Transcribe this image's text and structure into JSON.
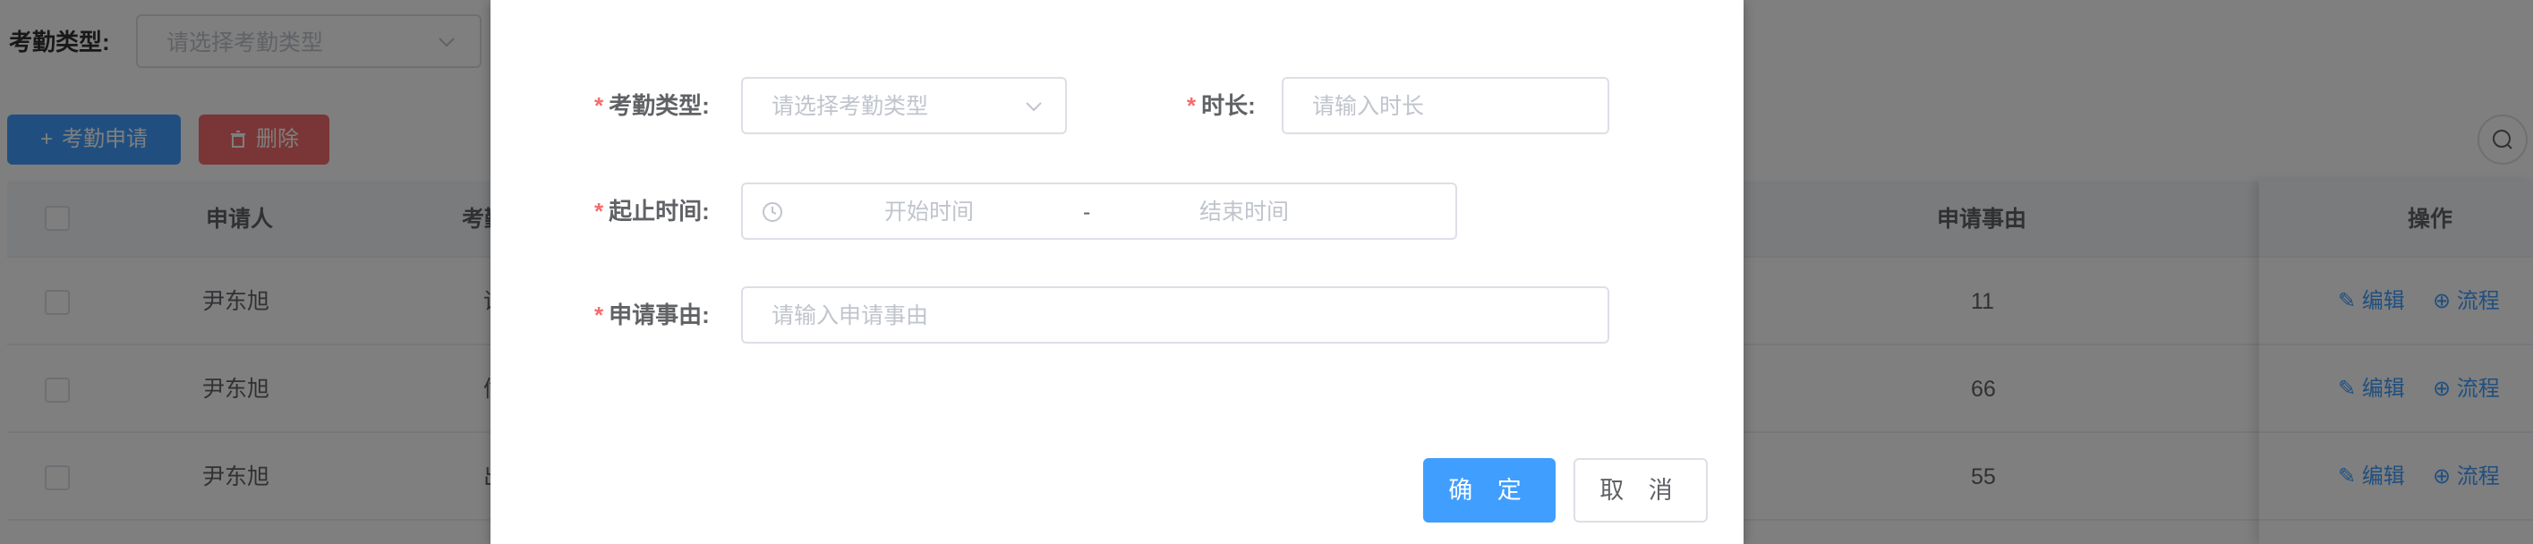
{
  "filter": {
    "label": "考勤类型:",
    "placeholder": "请选择考勤类型"
  },
  "toolbar": {
    "add_label": "考勤申请",
    "delete_label": "删除"
  },
  "table": {
    "headers": {
      "applicant": "申请人",
      "type_partial": "考勤",
      "reason": "申请事由",
      "actions": "操作"
    },
    "rows": [
      {
        "applicant": "尹东旭",
        "type_partial": "请",
        "reason": "11",
        "edit": "编辑",
        "flow": "流程"
      },
      {
        "applicant": "尹东旭",
        "type_partial": "偷",
        "reason": "66",
        "edit": "编辑",
        "flow": "流程"
      },
      {
        "applicant": "尹东旭",
        "type_partial": "出",
        "reason": "55",
        "edit": "编辑",
        "flow": "流程"
      }
    ]
  },
  "dialog": {
    "type_label": "考勤类型:",
    "type_placeholder": "请选择考勤类型",
    "duration_label": "时长:",
    "duration_placeholder": "请输入时长",
    "time_label": "起止时间:",
    "start_placeholder": "开始时间",
    "range_separator": "-",
    "end_placeholder": "结束时间",
    "reason_label": "申请事由:",
    "reason_placeholder": "请输入申请事由",
    "confirm_label": "确 定",
    "cancel_label": "取 消",
    "required_mark": "*"
  },
  "colors": {
    "primary": "#409eff",
    "danger": "#f56c6c",
    "mask": "rgba(0,0,0,0.5)"
  }
}
